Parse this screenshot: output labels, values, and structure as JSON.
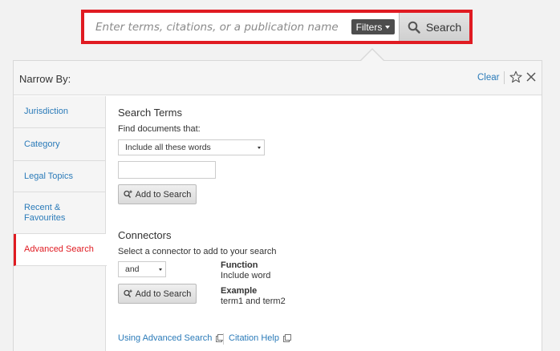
{
  "search": {
    "placeholder": "Enter terms, citations, or a publication name",
    "filters_label": "Filters",
    "search_label": "Search"
  },
  "header": {
    "title": "Narrow By:",
    "clear_label": "Clear"
  },
  "sidebar": {
    "items": [
      {
        "label": "Jurisdiction"
      },
      {
        "label": "Category"
      },
      {
        "label": "Legal Topics"
      },
      {
        "label": "Recent & Favourites"
      },
      {
        "label": "Advanced Search"
      }
    ],
    "active_index": 4
  },
  "search_terms": {
    "title": "Search Terms",
    "find_label": "Find documents that:",
    "mode_selected": "Include all these words",
    "term_value": "",
    "add_label": "Add to Search"
  },
  "connectors": {
    "title": "Connectors",
    "instruction": "Select a connector to add to your search",
    "selected": "and",
    "function_label": "Function",
    "function_value": "Include word",
    "example_label": "Example",
    "example_value": "term1 and term2",
    "add_label": "Add to Search"
  },
  "footer": {
    "advanced_link": "Using Advanced Search",
    "citation_link": "Citation Help"
  },
  "colors": {
    "accent_red": "#e01b22",
    "link_blue": "#2b7bb9"
  }
}
